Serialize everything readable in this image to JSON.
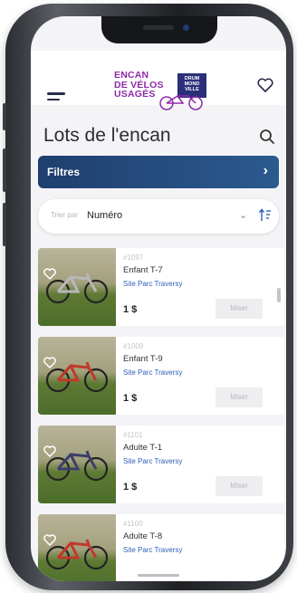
{
  "app": {
    "logo_lines": [
      "ENCAN",
      "DE VÉLOS",
      "USAGÉS"
    ],
    "logo_badge_lines": [
      "DRUM",
      "MOND",
      "VILLE"
    ]
  },
  "page": {
    "title": "Lots de l'encan"
  },
  "filters": {
    "label": "Filtres"
  },
  "sort": {
    "prefix": "Trier par",
    "value": "Numéro"
  },
  "lots": [
    {
      "number": "#1097",
      "title": "Enfant T-7",
      "site": "Site Parc Traversy",
      "price": "1 $",
      "bid_label": "Miser",
      "frame_color": "#b8b8b8"
    },
    {
      "number": "#1009",
      "title": "Enfant T-9",
      "site": "Site Parc Traversy",
      "price": "1 $",
      "bid_label": "Miser",
      "frame_color": "#c0392b"
    },
    {
      "number": "#1101",
      "title": "Adulte T-1",
      "site": "Site Parc Traversy",
      "price": "1 $",
      "bid_label": "Miser",
      "frame_color": "#3b3f6b"
    },
    {
      "number": "#1100",
      "title": "Adulte T-8",
      "site": "Site Parc Traversy",
      "price": "",
      "bid_label": "",
      "frame_color": "#c0392b"
    }
  ],
  "colors": {
    "accent": "#8f2aa8",
    "filters_bar": "#1f3f6e",
    "site_link": "#2b5fb8"
  }
}
